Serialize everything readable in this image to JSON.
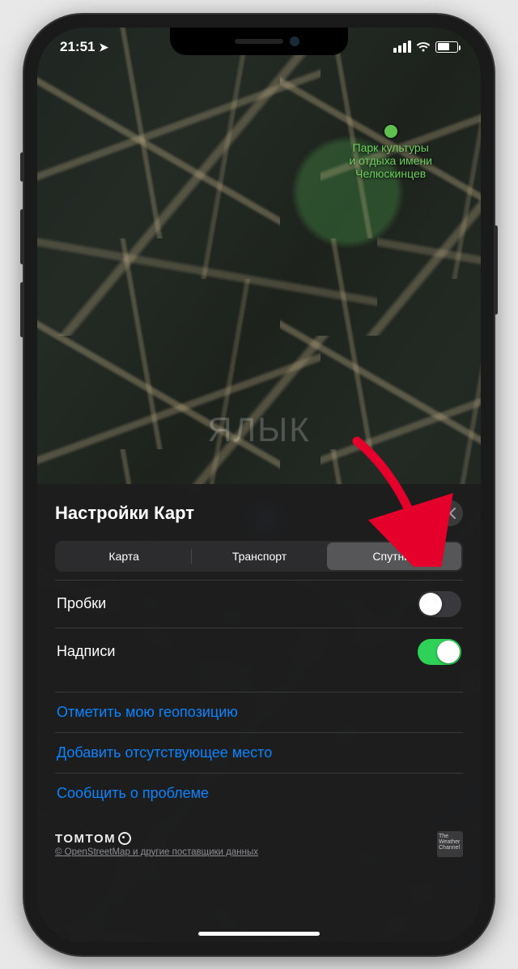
{
  "status": {
    "time": "21:51",
    "location_glyph": "➤"
  },
  "map": {
    "poi_line1": "Парк культуры",
    "poi_line2": "и отдыха имени",
    "poi_line3": "Челюскинцев",
    "watermark": "Я   ЛЫК"
  },
  "sheet": {
    "title": "Настройки Карт",
    "segments": {
      "map": "Карта",
      "transit": "Транспорт",
      "satellite": "Спутник",
      "selected_index": 2
    },
    "toggles": {
      "traffic": {
        "label": "Пробки",
        "on": false
      },
      "labels": {
        "label": "Надписи",
        "on": true
      }
    },
    "links": {
      "mark_location": "Отметить мою геопозицию",
      "add_place": "Добавить отсутствующее место",
      "report": "Сообщить о проблеме"
    },
    "attribution": {
      "tomtom": "TOMTOM",
      "osm": "© OpenStreetMap и другие поставщики данных",
      "weather_badge": "The Weather Channel"
    }
  },
  "colors": {
    "link": "#0a84ff",
    "toggle_on": "#30d158"
  }
}
